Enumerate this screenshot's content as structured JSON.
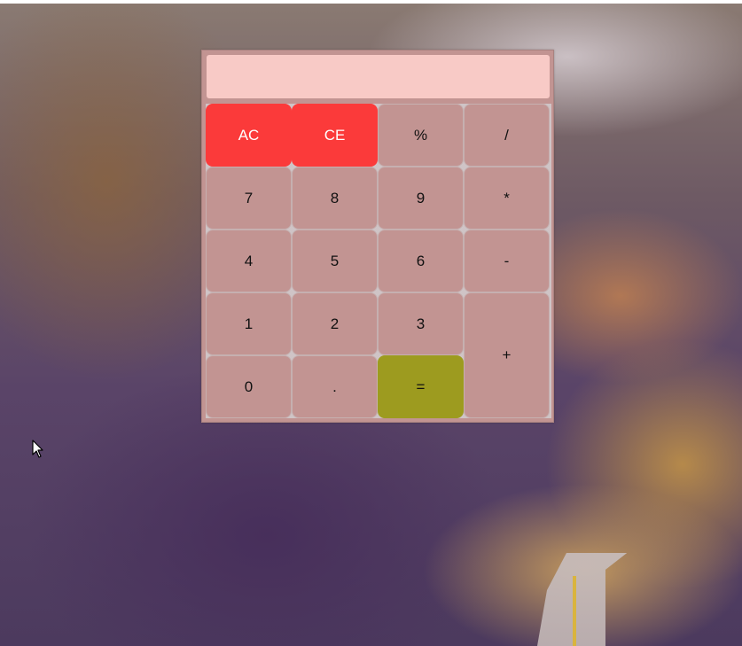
{
  "calculator": {
    "display": {
      "value": "",
      "placeholder": ""
    },
    "keys": {
      "ac": "AC",
      "ce": "CE",
      "percent": "%",
      "divide": "/",
      "seven": "7",
      "eight": "8",
      "nine": "9",
      "multiply": "*",
      "four": "4",
      "five": "5",
      "six": "6",
      "minus": "-",
      "one": "1",
      "two": "2",
      "three": "3",
      "plus": "+",
      "zero": "0",
      "decimal": ".",
      "equals": "="
    }
  },
  "colors": {
    "calculator_body": "#c29492",
    "display_background": "#f8cac6",
    "clear_keys": "#fb3a3a",
    "equals_key": "#9d9b1f",
    "number_keys": "#c29492"
  },
  "icons": {
    "pointer": "mouse-pointer-icon"
  }
}
